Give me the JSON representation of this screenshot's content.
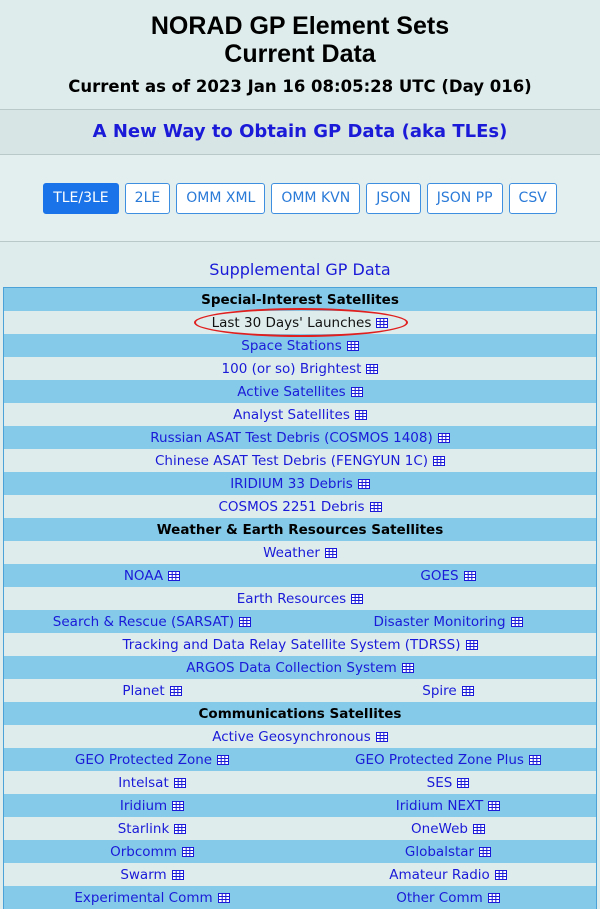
{
  "header": {
    "title_line1": "NORAD GP Element Sets",
    "title_line2": "Current Data",
    "subtitle": "Current as of 2023 Jan 16 08:05:28 UTC (Day 016)"
  },
  "panel": {
    "heading": "A New Way to Obtain GP Data (aka TLEs)",
    "formats": [
      "TLE/3LE",
      "2LE",
      "OMM XML",
      "OMM KVN",
      "JSON",
      "JSON PP",
      "CSV"
    ],
    "active_format": "TLE/3LE"
  },
  "supplemental_link": "Supplemental GP Data",
  "colors": {
    "section_bg": "#85cbe9",
    "link": "#1a1ad8",
    "highlight": "#e01f1f",
    "button": "#1a73e8"
  },
  "sections": {
    "special": {
      "title": "Special-Interest Satellites",
      "items": [
        "Last 30 Days' Launches",
        "Space Stations",
        "100 (or so) Brightest",
        "Active Satellites",
        "Analyst Satellites",
        "Russian ASAT Test Debris (COSMOS 1408)",
        "Chinese ASAT Test Debris (FENGYUN 1C)",
        "IRIDIUM 33 Debris",
        "COSMOS 2251 Debris"
      ]
    },
    "weather": {
      "title": "Weather & Earth Resources Satellites",
      "r1": "Weather",
      "r2a": "NOAA",
      "r2b": "GOES",
      "r3": "Earth Resources",
      "r4a": "Search & Rescue (SARSAT)",
      "r4b": "Disaster Monitoring",
      "r5": "Tracking and Data Relay Satellite System (TDRSS)",
      "r6": "ARGOS Data Collection System",
      "r7a": "Planet",
      "r7b": "Spire"
    },
    "comms": {
      "title": "Communications Satellites",
      "r1": "Active Geosynchronous",
      "pairs": [
        [
          "GEO Protected Zone",
          "GEO Protected Zone Plus"
        ],
        [
          "Intelsat",
          "SES"
        ],
        [
          "Iridium",
          "Iridium NEXT"
        ],
        [
          "Starlink",
          "OneWeb"
        ],
        [
          "Orbcomm",
          "Globalstar"
        ],
        [
          "Swarm",
          "Amateur Radio"
        ],
        [
          "Experimental Comm",
          "Other Comm"
        ]
      ]
    }
  },
  "icon": "table-grid-icon"
}
